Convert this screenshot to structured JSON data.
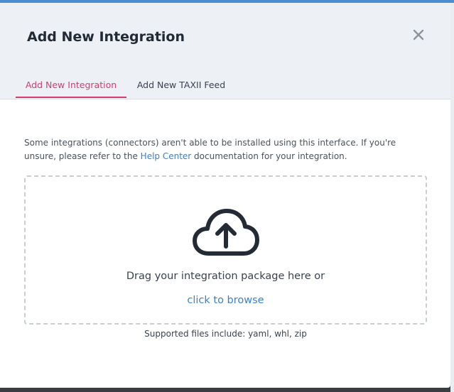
{
  "modal": {
    "title": "Add New Integration",
    "tabs": [
      {
        "label": "Add New Integration",
        "active": true
      },
      {
        "label": "Add New TAXII Feed",
        "active": false
      }
    ],
    "description_before_link": "Some integrations (connectors) aren't able to be installed using this interface. If you're unsure, please refer to the ",
    "help_link": "Help Center",
    "description_after_link": " documentation for your integration.",
    "dropzone": {
      "icon": "cloud-upload-icon",
      "drag_text": "Drag your integration package here or",
      "browse_link": "click to browse"
    },
    "supported_files": "Supported files include: yaml, whl, zip",
    "close_icon": "close-icon"
  },
  "colors": {
    "accent": "#d63b6e",
    "link": "#3b82c4",
    "header_bg": "#edf1f5",
    "top_bar": "#4a90d0"
  }
}
